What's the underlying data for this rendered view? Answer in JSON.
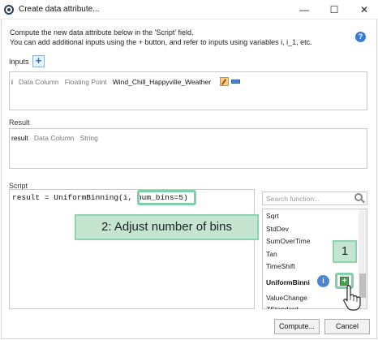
{
  "window": {
    "title": "Create data attribute...",
    "minimize": "—",
    "maximize": "☐",
    "close": "✕"
  },
  "description": {
    "line1": "Compute the new data attribute below in the 'Script' field.",
    "line2": "You can add additional inputs using the + button, and refer to inputs using variables i, i_1, etc.",
    "help": "?"
  },
  "inputs": {
    "label": "Inputs",
    "add_button": "+",
    "row": {
      "var": "i",
      "kind": "Data Column",
      "type": "Floating Point",
      "name": "Wind_Chill_Happyville_Weather"
    }
  },
  "result": {
    "label": "Result",
    "row": {
      "var": "result",
      "kind": "Data Column",
      "type": "String"
    }
  },
  "script": {
    "label": "Script",
    "prefix": "result = UniformBinning(i, ",
    "highlighted_arg": "num_bins=5",
    "suffix": ")"
  },
  "callouts": {
    "step2": "2: Adjust number of bins",
    "step1": "1"
  },
  "functions": {
    "search_placeholder": "Search function...",
    "items": [
      "Sqrt",
      "StdDev",
      "SumOverTime",
      "Tan",
      "TimeShift"
    ],
    "selected": "UniformBinni",
    "after": [
      "ValueChange",
      "ZStandard"
    ],
    "info": "i",
    "insert": "+"
  },
  "buttons": {
    "compute": "Compute...",
    "cancel": "Cancel"
  },
  "colors": {
    "callout_fill": "#c4e6d0",
    "callout_border": "#8ed3ad",
    "accent_blue": "#3a7bd5"
  }
}
